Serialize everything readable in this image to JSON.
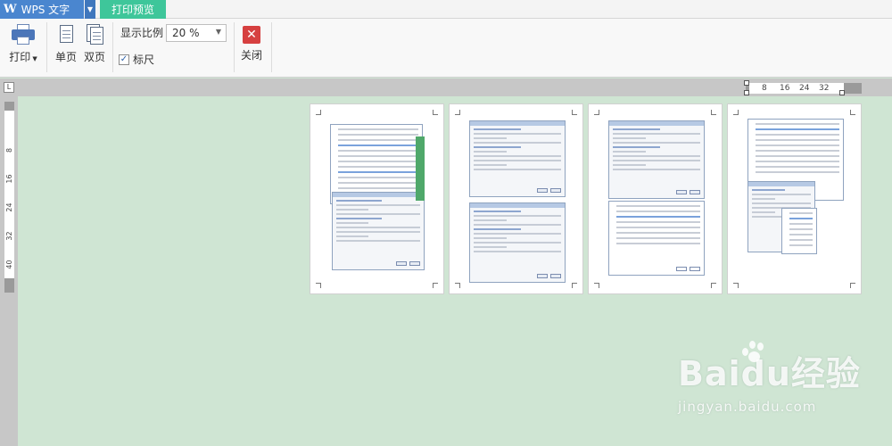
{
  "app": {
    "name": "WPS 文字",
    "logo": "W",
    "tab_active": "打印预览"
  },
  "toolbar": {
    "print_label": "打印",
    "single_label": "单页",
    "double_label": "双页",
    "zoom_label": "显示比例",
    "zoom_value": "20 %",
    "ruler_label": "标尺",
    "ruler_checked": true,
    "close_label": "关闭"
  },
  "hruler": {
    "ticks": [
      "8",
      "16",
      "24",
      "32"
    ]
  },
  "vruler": {
    "ticks": [
      "8",
      "16",
      "24",
      "32",
      "40"
    ]
  },
  "preview": {
    "page_count": 4
  },
  "watermark": {
    "logo": "Baidu经验",
    "url": "jingyan.baidu.com"
  },
  "colors": {
    "workspace": "#cfe5d3",
    "tab_active": "#3ec69a",
    "app_button": "#4a86cf",
    "close": "#d64040"
  }
}
